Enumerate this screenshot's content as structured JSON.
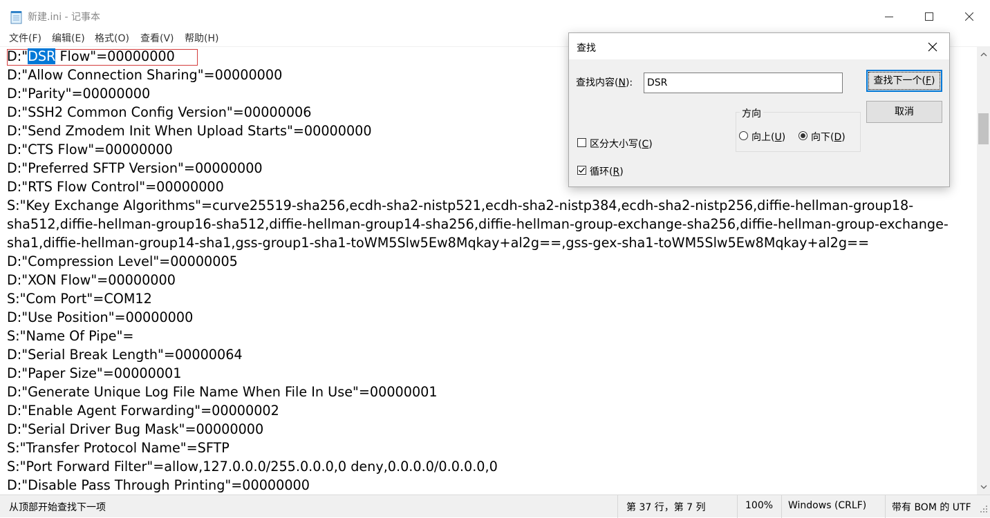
{
  "window": {
    "title": "新建.ini - 记事本",
    "icon": "notepad-icon"
  },
  "menu": [
    {
      "label": "文件(F)"
    },
    {
      "label": "编辑(E)"
    },
    {
      "label": "格式(O)"
    },
    {
      "label": "查看(V)"
    },
    {
      "label": "帮助(H)"
    }
  ],
  "editor": {
    "first_line_prefix": "D:\"",
    "first_line_selected": "DSR",
    "first_line_rest": " Flow\"=00000000",
    "lines": [
      "D:\"Allow Connection Sharing\"=00000000",
      "D:\"Parity\"=00000000",
      "D:\"SSH2 Common Config Version\"=00000006",
      "D:\"Send Zmodem Init When Upload Starts\"=00000000",
      "D:\"CTS Flow\"=00000000",
      "D:\"Preferred SFTP Version\"=00000000",
      "D:\"RTS Flow Control\"=00000000",
      "S:\"Key Exchange Algorithms\"=curve25519-sha256,ecdh-sha2-nistp521,ecdh-sha2-nistp384,ecdh-sha2-nistp256,diffie-hellman-group18-",
      "sha512,diffie-hellman-group16-sha512,diffie-hellman-group14-sha256,diffie-hellman-group-exchange-sha256,diffie-hellman-group-exchange-",
      "sha1,diffie-hellman-group14-sha1,gss-group1-sha1-toWM5Slw5Ew8Mqkay+al2g==,gss-gex-sha1-toWM5Slw5Ew8Mqkay+al2g==",
      "D:\"Compression Level\"=00000005",
      "D:\"XON Flow\"=00000000",
      "S:\"Com Port\"=COM12",
      "D:\"Use Position\"=00000000",
      "S:\"Name Of Pipe\"=",
      "D:\"Serial Break Length\"=00000064",
      "D:\"Paper Size\"=00000001",
      "D:\"Generate Unique Log File Name When File In Use\"=00000001",
      "D:\"Enable Agent Forwarding\"=00000002",
      "D:\"Serial Driver Bug Mask\"=00000000",
      "S:\"Transfer Protocol Name\"=SFTP",
      "S:\"Port Forward Filter\"=allow,127.0.0.0/255.0.0.0,0 deny,0.0.0.0/0.0.0.0,0",
      "D:\"Disable Pass Through Printing\"=00000000"
    ]
  },
  "find_dialog": {
    "title": "查找",
    "find_what_label": "查找内容(",
    "find_what_key": "N",
    "find_what_suffix": "):",
    "find_what_value": "DSR",
    "find_next_label_pre": "查找下一个(",
    "find_next_key": "F",
    "find_next_label_post": ")",
    "cancel_label": "取消",
    "direction_title": "方向",
    "up_pre": "向上(",
    "up_key": "U",
    "up_post": ")",
    "down_pre": "向下(",
    "down_key": "D",
    "down_post": ")",
    "direction_selected": "down",
    "match_case_pre": "区分大小写(",
    "match_case_key": "C",
    "match_case_post": ")",
    "match_case_checked": false,
    "wrap_pre": "循环(",
    "wrap_key": "R",
    "wrap_post": ")",
    "wrap_checked": true
  },
  "status": {
    "message": "从顶部开始查找下一项",
    "position": "第 37 行，第 7 列",
    "zoom": "100%",
    "line_ending": "Windows (CRLF)",
    "encoding": "带有 BOM 的 UTF"
  },
  "colors": {
    "selection": "#0078d7",
    "find_highlight_border": "#d33b3b"
  }
}
